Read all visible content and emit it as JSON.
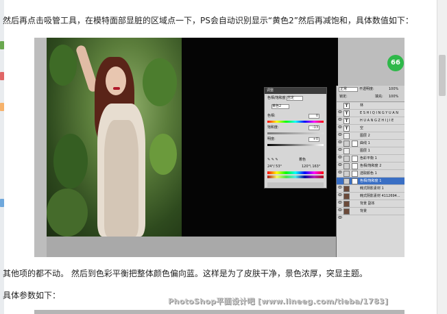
{
  "article": {
    "paragraph_1": "然后再点击吸管工具，在模特面部显脏的区域点一下，PS会自动识别显示“黄色2”然后再减饱和，具体数值如下：",
    "paragraph_2": "其他项的都不动。 然后到色彩平衡把整体颜色偏向蓝。这样是为了皮肤干净，景色浓厚，突显主题。",
    "paragraph_3": "具体参数如下："
  },
  "badge": {
    "value": "66"
  },
  "hue_sat_panel": {
    "title": "调整",
    "preset_label": "色相/饱和度",
    "preset_value": "自定",
    "channel_value": "黄色2",
    "hue_label": "色相:",
    "hue_value": "0",
    "saturation_label": "饱和度:",
    "saturation_value": "-13",
    "lightness_label": "明度:",
    "lightness_value": "+0",
    "colorize_label": "着色",
    "range_left": "24°/ 53°",
    "range_right": "120°\\ 163°",
    "tool_glyphs": "✎ ✎ ✎"
  },
  "layers_panel": {
    "blend_mode": "正常",
    "opacity_label": "不透明度:",
    "opacity_value": "100%",
    "lock_label": "锁定:",
    "fill_label": "填充:",
    "fill_value": "100%",
    "layers": [
      {
        "name": "林",
        "type": "text",
        "glyph": "T"
      },
      {
        "name": "E S H I Q I N G Y U A N",
        "type": "text",
        "glyph": "T"
      },
      {
        "name": "H U A N G Z H I J I E",
        "type": "text",
        "glyph": "T"
      },
      {
        "name": "空",
        "type": "text",
        "glyph": "T"
      },
      {
        "name": "图层 2",
        "type": "pixel",
        "glyph": ""
      },
      {
        "name": "曲线 1",
        "type": "adjust",
        "glyph": ""
      },
      {
        "name": "图层 1",
        "type": "pixel",
        "glyph": ""
      },
      {
        "name": "色彩平衡 1",
        "type": "adjust",
        "glyph": ""
      },
      {
        "name": "色相/饱和度 2",
        "type": "adjust",
        "glyph": ""
      },
      {
        "name": "选取颜色 1",
        "type": "adjust",
        "glyph": ""
      },
      {
        "name": "色相/饱和度 1",
        "type": "adjust",
        "glyph": ""
      },
      {
        "name": "韩式阴影素材 1",
        "type": "pixel",
        "glyph": ""
      },
      {
        "name": "韩式阴影素材 4112694...",
        "type": "pixel",
        "glyph": ""
      },
      {
        "name": "背景 副本",
        "type": "pixel",
        "glyph": ""
      },
      {
        "name": "背景",
        "type": "pixel",
        "glyph": ""
      }
    ]
  },
  "watermark": {
    "text": "PhotoShop平面设计吧 [www.lineeg.com/tieba/1783]"
  },
  "colors": {
    "badge": "#2fb84a",
    "active_layer": "#3a6fc4",
    "canvas": "#050505"
  }
}
